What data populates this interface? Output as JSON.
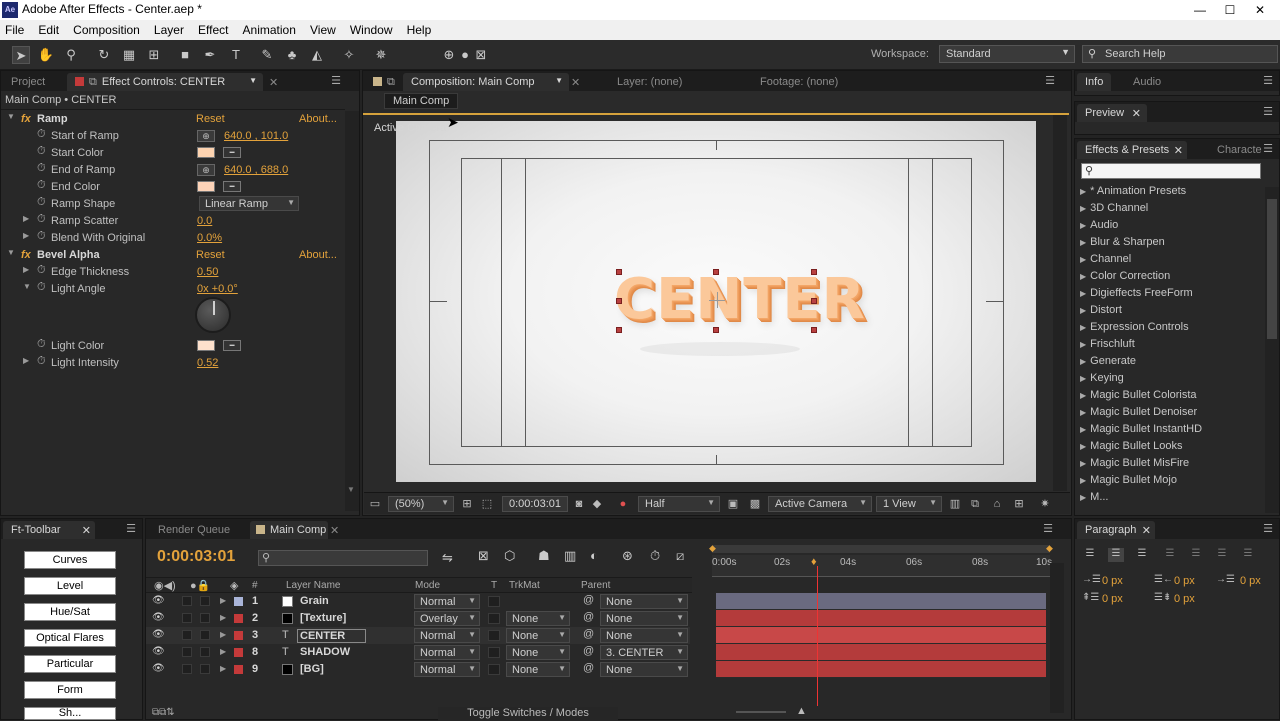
{
  "app": {
    "title": "Adobe After Effects - Center.aep *",
    "icon": "Ae"
  },
  "window_controls": {
    "minimize": "—",
    "maximize": "☐",
    "close": "✕"
  },
  "menu": [
    "File",
    "Edit",
    "Composition",
    "Layer",
    "Effect",
    "Animation",
    "View",
    "Window",
    "Help"
  ],
  "workspace": {
    "label": "Workspace:",
    "value": "Standard"
  },
  "search_help": {
    "placeholder": "Search Help"
  },
  "left_panel": {
    "tabs": [
      "Project",
      "Effect Controls: CENTER"
    ],
    "breadcrumb": "Main Comp • CENTER",
    "effects": [
      {
        "name": "Ramp",
        "reset": "Reset",
        "about": "About..."
      },
      {
        "name": "Bevel Alpha",
        "reset": "Reset",
        "about": "About..."
      }
    ],
    "ramp_props": {
      "start_of_ramp": {
        "label": "Start of Ramp",
        "value": "640.0 , 101.0"
      },
      "start_color": {
        "label": "Start Color",
        "color": "#fdd3b0"
      },
      "end_of_ramp": {
        "label": "End of Ramp",
        "value": "640.0 , 688.0"
      },
      "end_color": {
        "label": "End Color",
        "color": "#fdd3b8"
      },
      "ramp_shape": {
        "label": "Ramp Shape",
        "value": "Linear Ramp"
      },
      "ramp_scatter": {
        "label": "Ramp Scatter",
        "value": "0.0"
      },
      "blend": {
        "label": "Blend With Original",
        "value": "0.0%"
      }
    },
    "bevel_props": {
      "edge_thickness": {
        "label": "Edge Thickness",
        "value": "0.50"
      },
      "light_angle": {
        "label": "Light Angle",
        "value": "0x +0.0°"
      },
      "light_color": {
        "label": "Light Color",
        "color": "#fde0cc"
      },
      "light_intensity": {
        "label": "Light Intensity",
        "value": "0.52"
      }
    }
  },
  "comp_panel": {
    "tabs": [
      "Composition: Main Comp",
      "Layer: (none)",
      "Footage: (none)"
    ],
    "subtab": "Main Comp",
    "camera_label": "Active Camera",
    "comp_text": "CENTER",
    "footer": {
      "zoom": "(50%)",
      "timecode": "0:00:03:01",
      "resolution": "Half",
      "camera": "Active Camera",
      "views": "1 View"
    }
  },
  "right_panel": {
    "tabs_top": [
      "Info",
      "Audio"
    ],
    "preview_tab": "Preview",
    "effects_tabs": [
      "Effects & Presets",
      "Characte"
    ],
    "categories": [
      "* Animation Presets",
      "3D Channel",
      "Audio",
      "Blur & Sharpen",
      "Channel",
      "Color Correction",
      "Digieffects FreeForm",
      "Distort",
      "Expression Controls",
      "Frischluft",
      "Generate",
      "Keying",
      "Magic Bullet Colorista",
      "Magic Bullet Denoiser",
      "Magic Bullet InstantHD",
      "Magic Bullet Looks",
      "Magic Bullet MisFire",
      "Magic Bullet Mojo",
      "M..."
    ]
  },
  "ft_toolbar": {
    "tab": "Ft-Toolbar",
    "buttons": [
      "Curves",
      "Level",
      "Hue/Sat",
      "Optical Flares",
      "Particular",
      "Form",
      "Sh..."
    ]
  },
  "timeline": {
    "tabs": [
      "Render Queue",
      "Main Comp"
    ],
    "timecode": "0:00:03:01",
    "headers": {
      "num": "#",
      "layer_name": "Layer Name",
      "mode": "Mode",
      "t": "T",
      "trkmat": "TrkMat",
      "parent": "Parent"
    },
    "ruler": [
      "0:00s",
      "02s",
      "04s",
      "06s",
      "08s",
      "10s"
    ],
    "layers": [
      {
        "num": "1",
        "name": "Grain",
        "mode": "Normal",
        "trkmat": "",
        "parent": "None",
        "label_color": "#a9b4d8",
        "icon_color": "#ffffff",
        "bar_color": "#6a6a80"
      },
      {
        "num": "2",
        "name": "[Texture]",
        "mode": "Overlay",
        "trkmat": "None",
        "parent": "None",
        "label_color": "#c43a3a",
        "icon_color": "#000000",
        "bar_color": "#b43b3b"
      },
      {
        "num": "3",
        "name": "CENTER",
        "mode": "Normal",
        "trkmat": "None",
        "parent": "None",
        "label_color": "#c43a3a",
        "icon_color": "text",
        "bar_color": "#c84848"
      },
      {
        "num": "8",
        "name": "SHADOW",
        "mode": "Normal",
        "trkmat": "None",
        "parent": "3. CENTER",
        "label_color": "#c43a3a",
        "icon_color": "text",
        "bar_color": "#b43b3b"
      },
      {
        "num": "9",
        "name": "[BG]",
        "mode": "Normal",
        "trkmat": "None",
        "parent": "None",
        "label_color": "#c43a3a",
        "icon_color": "#000000",
        "bar_color": "#b43b3b"
      }
    ],
    "footer": "Toggle Switches / Modes"
  },
  "paragraph": {
    "tab": "Paragraph",
    "fields": [
      "0 px",
      "0 px",
      "0 px",
      "0 px",
      "0 px"
    ]
  }
}
